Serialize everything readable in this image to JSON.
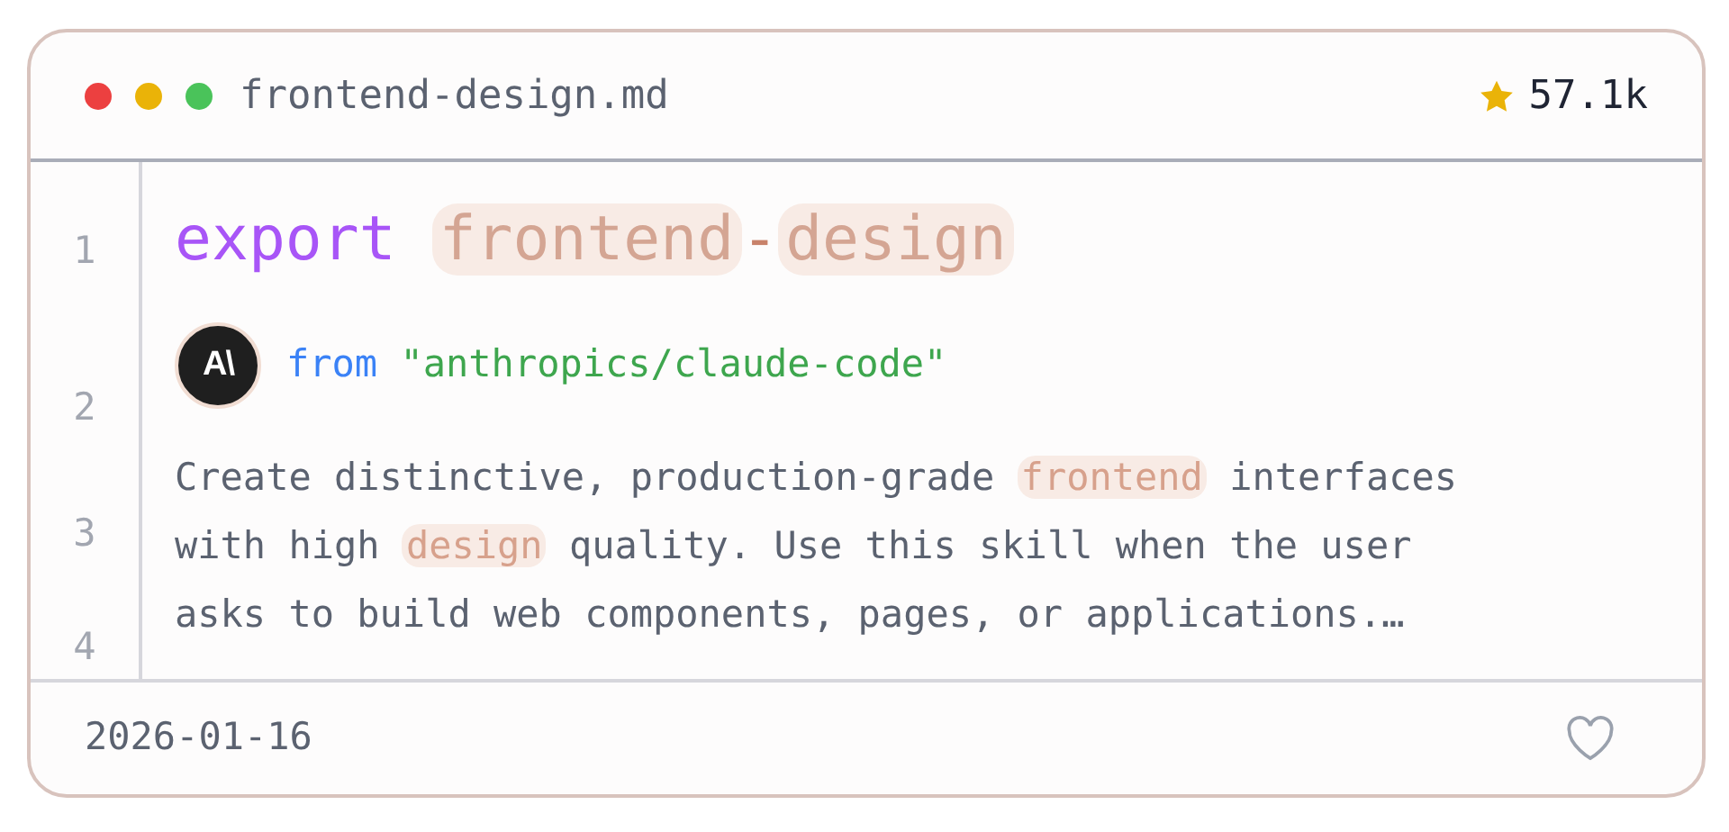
{
  "window": {
    "title": "frontend-design.md",
    "stars": "57.1k"
  },
  "gutter": [
    "1",
    "2",
    "3",
    "4"
  ],
  "title": [
    {
      "text": "export",
      "kind": "keyword"
    },
    {
      "text": "frontend",
      "kind": "name"
    },
    {
      "text": "-",
      "kind": "dash"
    },
    {
      "text": "design",
      "kind": "name"
    }
  ],
  "source": {
    "avatar": "A\\",
    "keyword": "from",
    "path": "\"anthropics/claude-code\""
  },
  "description": [
    [
      {
        "text": "Create distinctive, production-grade ",
        "highlight": false
      },
      {
        "text": "frontend",
        "highlight": true
      },
      {
        "text": " interfaces",
        "highlight": false
      }
    ],
    [
      {
        "text": "with high ",
        "highlight": false
      },
      {
        "text": "design",
        "highlight": true
      },
      {
        "text": " quality. Use this skill when the user",
        "highlight": false
      }
    ],
    [
      {
        "text": "asks to build web components, pages, or applications.…",
        "highlight": false
      }
    ]
  ],
  "footer": {
    "date": "2026-01-16",
    "liked": false
  }
}
